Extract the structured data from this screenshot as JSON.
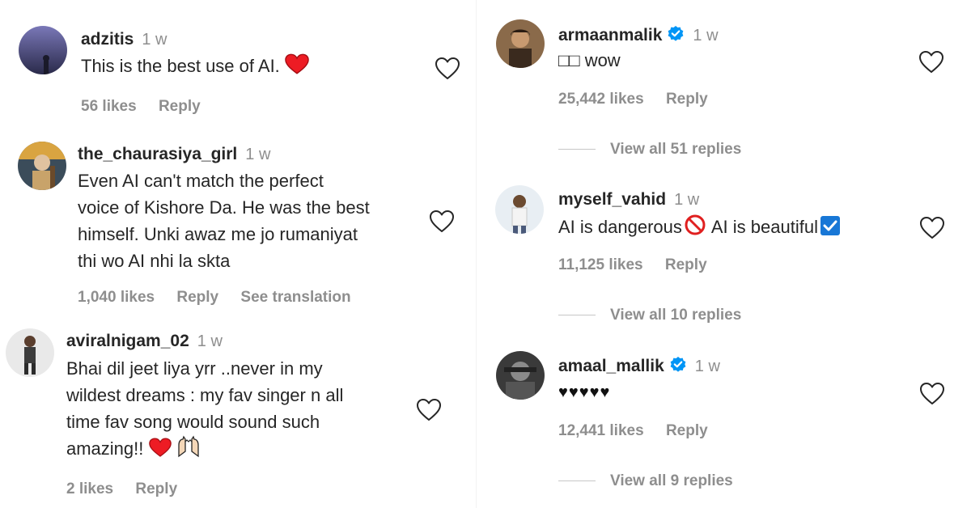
{
  "comments_left": [
    {
      "username": "adzitis",
      "time": "1 w",
      "text": "This is the best use of AI.",
      "likes": "56 likes",
      "reply": "Reply"
    },
    {
      "username": "the_chaurasiya_girl",
      "time": "1 w",
      "text_lines": [
        "Even AI can't match the perfect",
        "voice of Kishore Da. He was the best",
        "himself. Unki awaz me jo rumaniyat",
        "thi wo AI nhi la skta"
      ],
      "likes": "1,040 likes",
      "reply": "Reply",
      "translate": "See translation"
    },
    {
      "username": "aviralnigam_02",
      "time": "1 w",
      "text_lines": [
        "Bhai dil jeet liya yrr ..never in my",
        "wildest dreams : my fav singer n all",
        "time fav song would sound such",
        "amazing!!"
      ],
      "likes": "2 likes",
      "reply": "Reply"
    }
  ],
  "comments_right": [
    {
      "username": "armaanmalik",
      "verified": true,
      "time": "1 w",
      "text": "□□ wow",
      "likes": "25,442 likes",
      "reply": "Reply",
      "view_replies": "View all 51 replies"
    },
    {
      "username": "myself_vahid",
      "time": "1 w",
      "text_a": "AI is dangerous",
      "text_b": "AI is beautiful",
      "likes": "11,125 likes",
      "reply": "Reply",
      "view_replies": "View all 10 replies"
    },
    {
      "username": "amaal_mallik",
      "verified": true,
      "time": "1 w",
      "text": "♥♥♥♥♥",
      "likes": "12,441 likes",
      "reply": "Reply",
      "view_replies": "View all 9 replies"
    }
  ],
  "colors": {
    "text": "#262626",
    "muted": "#8e8e8e",
    "verified": "#0095f6",
    "heart_red": "#ed1c24"
  },
  "icons": [
    "heart-outline-icon",
    "verified-badge-icon",
    "red-heart-emoji-icon",
    "prohibited-emoji-icon",
    "check-box-emoji-icon",
    "raised-hands-emoji-icon"
  ]
}
